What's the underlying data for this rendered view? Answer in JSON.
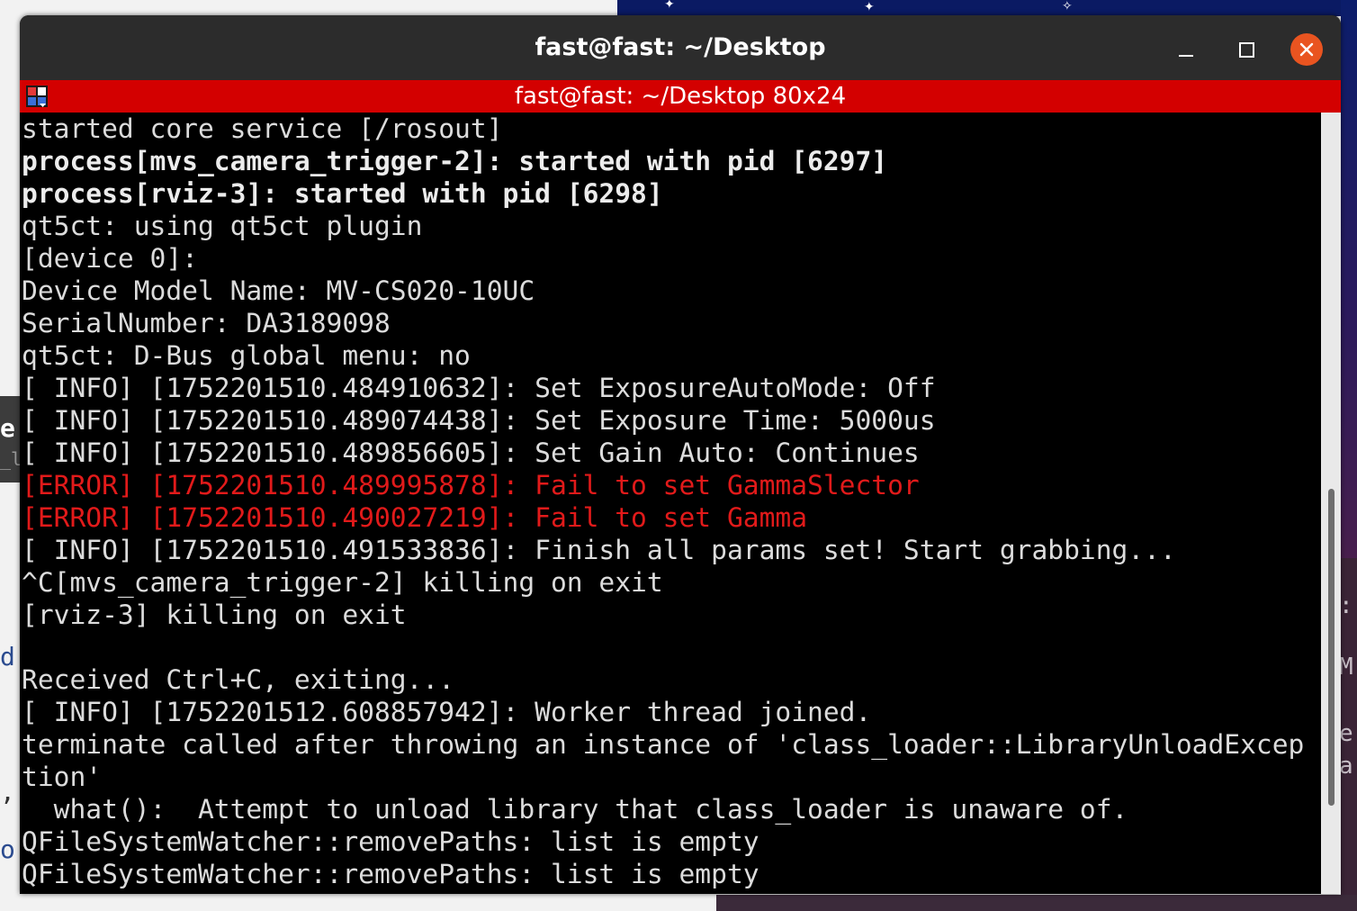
{
  "window": {
    "title": "fast@fast: ~/Desktop",
    "inner_title": "fast@fast: ~/Desktop 80x24",
    "controls": [
      "minimize",
      "maximize",
      "close"
    ]
  },
  "colors": {
    "titlebar": "#2c2c2c",
    "inner_bar": "#d30000",
    "close_button": "#e95420",
    "terminal_bg": "#000000",
    "text": "#dcdcdc",
    "error": "#e11a1a"
  },
  "terminal": {
    "lines": [
      {
        "text": "started core service [/rosout]",
        "style": "normal"
      },
      {
        "text": "process[mvs_camera_trigger-2]: started with pid [6297]",
        "style": "bold"
      },
      {
        "text": "process[rviz-3]: started with pid [6298]",
        "style": "bold"
      },
      {
        "text": "qt5ct: using qt5ct plugin",
        "style": "normal"
      },
      {
        "text": "[device 0]:",
        "style": "normal"
      },
      {
        "text": "Device Model Name: MV-CS020-10UC",
        "style": "normal"
      },
      {
        "text": "SerialNumber: DA3189098",
        "style": "normal"
      },
      {
        "text": "qt5ct: D-Bus global menu: no",
        "style": "normal"
      },
      {
        "text": "[ INFO] [1752201510.484910632]: Set ExposureAutoMode: Off",
        "style": "normal"
      },
      {
        "text": "[ INFO] [1752201510.489074438]: Set Exposure Time: 5000us",
        "style": "normal"
      },
      {
        "text": "[ INFO] [1752201510.489856605]: Set Gain Auto: Continues",
        "style": "normal"
      },
      {
        "text": "[ERROR] [1752201510.489995878]: Fail to set GammaSlector",
        "style": "error"
      },
      {
        "text": "[ERROR] [1752201510.490027219]: Fail to set Gamma",
        "style": "error"
      },
      {
        "text": "[ INFO] [1752201510.491533836]: Finish all params set! Start grabbing...",
        "style": "normal"
      },
      {
        "text": "^C[mvs_camera_trigger-2] killing on exit",
        "style": "normal"
      },
      {
        "text": "[rviz-3] killing on exit",
        "style": "normal"
      },
      {
        "text": "",
        "style": "normal"
      },
      {
        "text": "Received Ctrl+C, exiting...",
        "style": "normal"
      },
      {
        "text": "[ INFO] [1752201512.608857942]: Worker thread joined.",
        "style": "normal"
      },
      {
        "text": "terminate called after throwing an instance of 'class_loader::LibraryUnloadExcep",
        "style": "normal"
      },
      {
        "text": "tion'",
        "style": "normal"
      },
      {
        "text": "  what():  Attempt to unload library that class_loader is unaware of.",
        "style": "normal"
      },
      {
        "text": "QFileSystemWatcher::removePaths: list is empty",
        "style": "normal"
      },
      {
        "text": "QFileSystemWatcher::removePaths: list is empty",
        "style": "normal"
      }
    ]
  },
  "behind_left": [
    "e",
    "_l",
    "d",
    ",",
    "o"
  ],
  "behind_right": [
    ":",
    "M",
    "e",
    "a"
  ]
}
